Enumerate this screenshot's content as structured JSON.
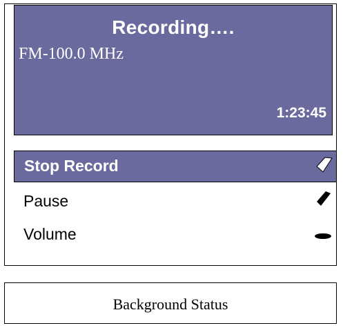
{
  "recording": {
    "title": "Recording….",
    "frequency": "FM-100.0 MHz",
    "elapsed": "1:23:45"
  },
  "menu": {
    "items": [
      {
        "label": "Stop Record",
        "selected": true,
        "icon": "rotary-knob-diagonal-up-icon"
      },
      {
        "label": "Pause",
        "selected": false,
        "icon": "rotary-knob-diagonal-icon"
      },
      {
        "label": "Volume",
        "selected": false,
        "icon": "rotary-knob-horizontal-icon"
      }
    ]
  },
  "status": {
    "text": "Background Status"
  },
  "colors": {
    "panel": "#6a6a9e",
    "text_on_panel": "#ffffff",
    "border": "#000000"
  }
}
